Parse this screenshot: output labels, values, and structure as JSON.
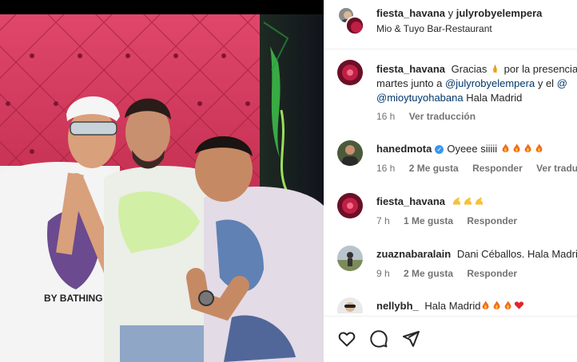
{
  "photo": {
    "alt_icons": "photo"
  },
  "header": {
    "user1": "fiesta_havana",
    "connector": "y",
    "user2": "julyrobyelempera",
    "location": "Mio & Tuyo Bar-Restaurant"
  },
  "comments": [
    {
      "user": "fiesta_havana",
      "line1_prefix": "Gracias",
      "line1_suffix": "por la presencia",
      "line2_prefix": "martes junto a",
      "line2_mention": "@julyrobyelempera",
      "line2_suffix": "y el",
      "line2_mention2": "@",
      "line3_mention": "@mioytuyohabana",
      "line3_suffix": "Hala Madrid",
      "time": "16 h",
      "reply": "Ver traducción"
    },
    {
      "user": "hanedmota",
      "text": "Oyeee siiiii",
      "time": "16 h",
      "likes": "2 Me gusta",
      "reply": "Responder",
      "translate": "Ver traducción"
    },
    {
      "user": "fiesta_havana",
      "time": "7 h",
      "likes": "1 Me gusta",
      "reply": "Responder"
    },
    {
      "user": "zuaznabaralain",
      "text": "Dani Céballos. Hala Madrid",
      "time": "9 h",
      "likes": "2 Me gusta",
      "reply": "Responder"
    },
    {
      "user": "nellybh_",
      "text": "Hala Madrid"
    }
  ],
  "icons": {
    "like": "heart-icon",
    "comment": "comment-icon",
    "share": "send-icon",
    "flame": "fire-emoji",
    "pray": "folded-hands-emoji",
    "muscle": "flexed-biceps-emoji",
    "red_heart": "red-heart-emoji"
  },
  "colors": {
    "mention": "#00376b",
    "meta": "#737373",
    "verified": "#3897f0"
  }
}
